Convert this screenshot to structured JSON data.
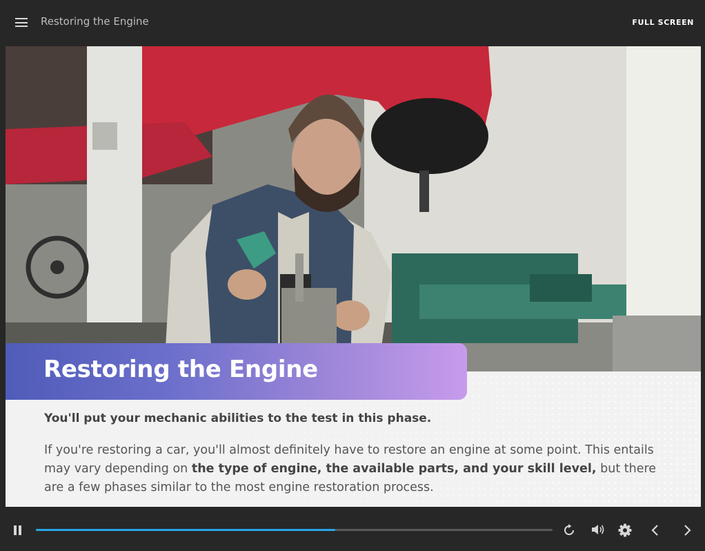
{
  "topbar": {
    "menu_icon": "hamburger-menu-icon",
    "title": "Restoring the Engine",
    "fullscreen_label": "FULL SCREEN"
  },
  "slide": {
    "heading": "Restoring the Engine",
    "lead": "You'll put your mechanic abilities to the test in this phase.",
    "body_part1": "If you're restoring a car, you'll almost definitely have to restore an engine at some point. This entails may vary depending on ",
    "body_bold": "the type of engine, the available parts, and your skill level,",
    "body_part2": " but there are a few phases similar to the most engine restoration process.",
    "banner_gradient": [
      "#4f5cb8",
      "#c79bec"
    ]
  },
  "player": {
    "progress": 0.58,
    "progress_color": "#29a6e8",
    "controls": [
      "pause-icon",
      "replay-icon",
      "volume-icon",
      "settings-gear-icon",
      "chevron-left-icon",
      "chevron-right-icon"
    ]
  }
}
